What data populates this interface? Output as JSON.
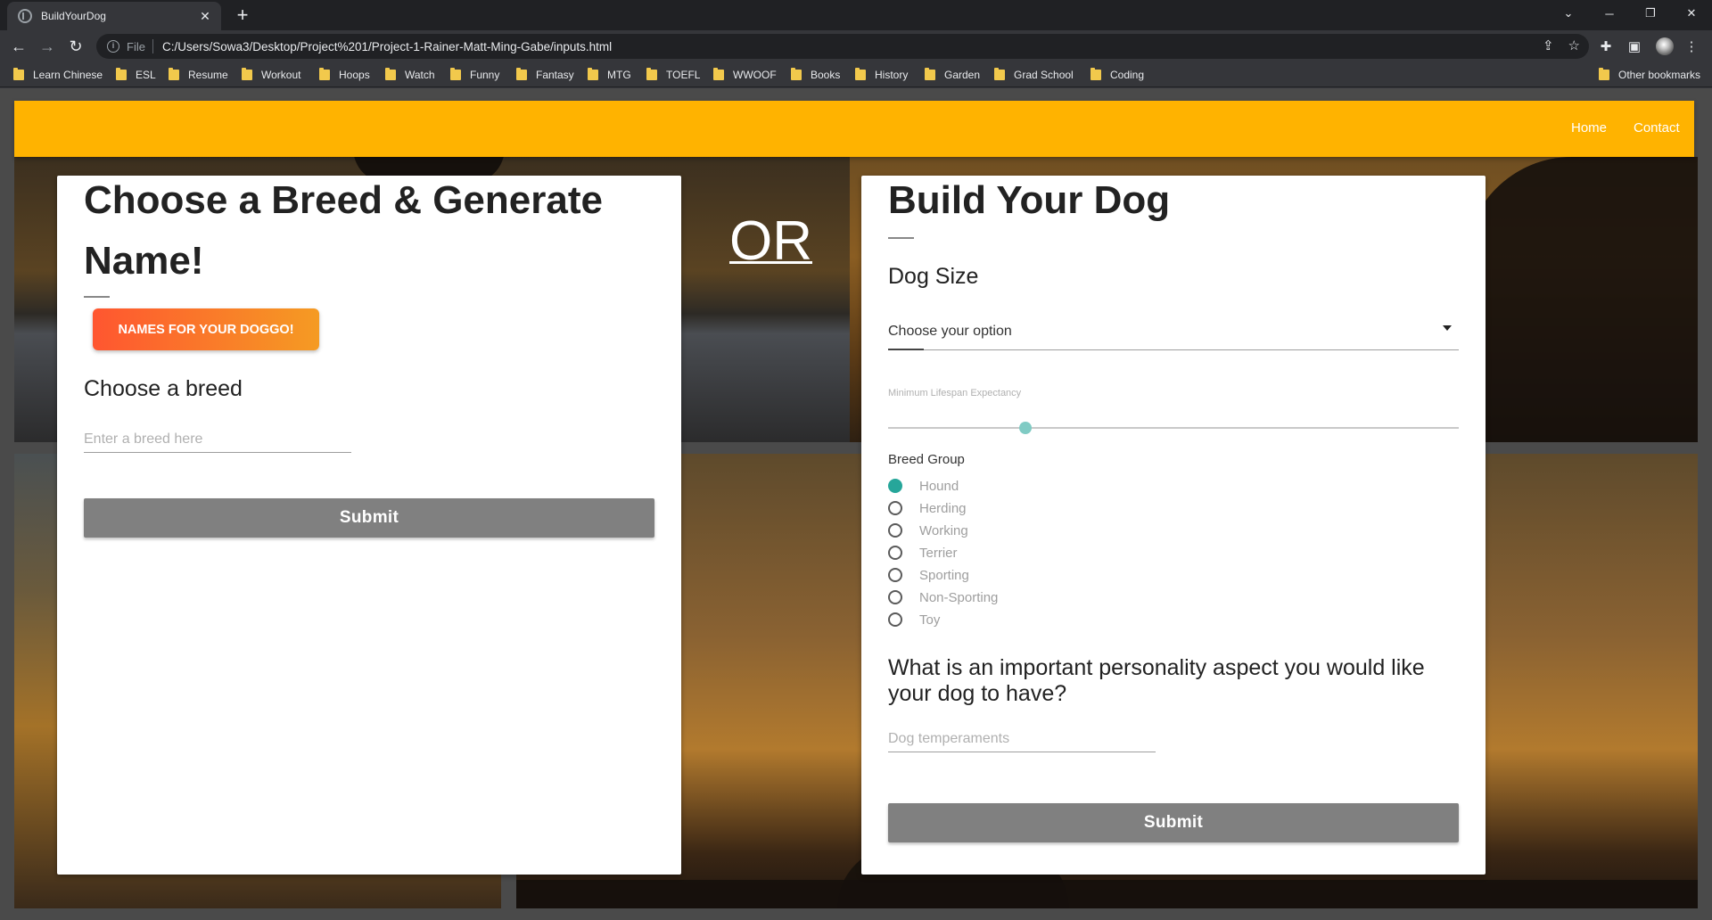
{
  "browser": {
    "tab_title": "BuildYourDog",
    "url_scheme": "File",
    "url": "C:/Users/Sowa3/Desktop/Project%201/Project-1-Rainer-Matt-Ming-Gabe/inputs.html",
    "bookmarks": [
      "Learn Chinese",
      "ESL",
      "Resume",
      "Workout",
      "Hoops",
      "Watch",
      "Funny",
      "Fantasy",
      "MTG",
      "TOEFL",
      "WWOOF",
      "Books",
      "History",
      "Garden",
      "Grad School",
      "Coding"
    ],
    "other_bookmarks": "Other bookmarks"
  },
  "nav": {
    "home": "Home",
    "contact": "Contact",
    "color": "#ffb300"
  },
  "left_card": {
    "title_line1": "Choose a Breed & Generate",
    "title_line2": "Name!",
    "names_button": "NAMES FOR YOUR DOGGO!",
    "choose_breed": "Choose a breed",
    "breed_placeholder": "Enter a breed here",
    "submit": "Submit"
  },
  "or_text": "OR",
  "right_card": {
    "title": "Build Your Dog",
    "dog_size_label": "Dog Size",
    "select_value": "Choose your option",
    "lifespan_label": "Minimum Lifespan Expectancy",
    "lifespan_value_fraction": 0.24,
    "breed_group_label": "Breed Group",
    "breed_groups": [
      "Hound",
      "Herding",
      "Working",
      "Terrier",
      "Sporting",
      "Non-Sporting",
      "Toy"
    ],
    "selected_group": "Hound",
    "question": "What is an important personality aspect you would like your dog to have?",
    "temperament_placeholder": "Dog temperaments",
    "submit": "Submit"
  }
}
